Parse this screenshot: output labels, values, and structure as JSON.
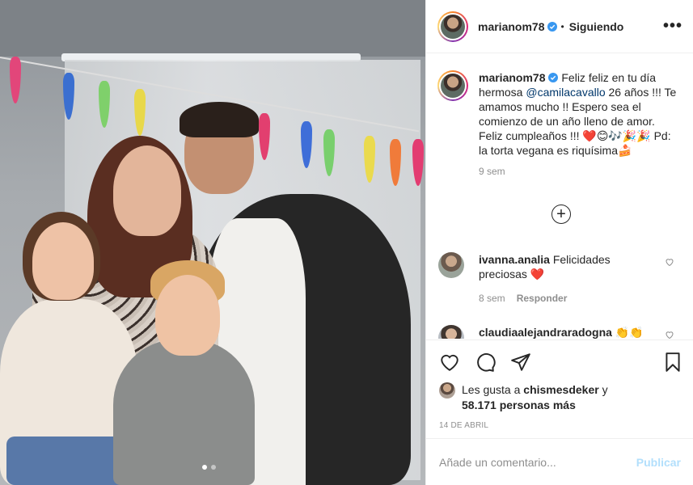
{
  "post": {
    "username": "marianom78",
    "follow_status": "Siguiendo",
    "more_label": "•••"
  },
  "caption": {
    "username": "marianom78",
    "text_1": " Feliz feliz en tu día hermosa ",
    "mention": "@camilacavallo",
    "text_2": " 26 años !!! Te amamos mucho !! Espero sea el comienzo de un año lleno de amor. Feliz cumpleaños !!! ❤️😊🎶🎉🎉 Pd: la torta vegana es riquísima🍰",
    "time": "9 sem"
  },
  "load_more_icon": "plus-circle-icon",
  "comments": [
    {
      "username": "ivanna.analia",
      "text": " Felicidades preciosas ❤️",
      "time": "8 sem",
      "reply": "Responder"
    },
    {
      "username": "claudiaalejandraradogna",
      "text": " 👏👏"
    }
  ],
  "likes": {
    "prefix": "Les gusta a ",
    "user": "chismesdeker",
    "suffix": " y",
    "count": "58.171 personas más"
  },
  "date": "14 DE ABRIL",
  "comment_box": {
    "placeholder": "Añade un comentario...",
    "publish": "Publicar"
  },
  "colors": {
    "accent": "#0095f6",
    "publish_disabled": "#b2dffc",
    "verified": "#3897f0",
    "heart": "#ed4956"
  },
  "carousel": {
    "slides": 2,
    "active": 1
  }
}
